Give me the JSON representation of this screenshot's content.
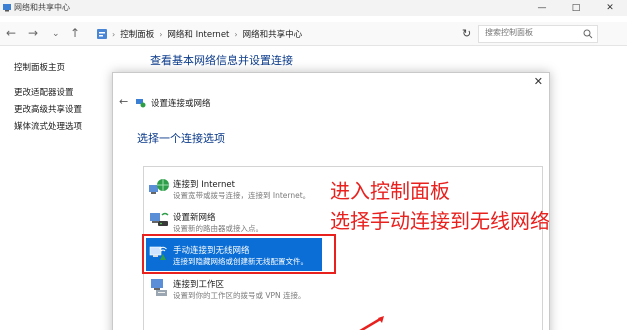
{
  "window": {
    "title": "网络和共享中心",
    "controls": {
      "minimize": "—",
      "maximize": "□",
      "close": "✕"
    }
  },
  "addressbar": {
    "breadcrumbs": [
      "控制面板",
      "网络和 Internet",
      "网络和共享中心"
    ],
    "search_placeholder": "搜索控制面板"
  },
  "left_nav": {
    "home": "控制面板主页",
    "items": [
      "更改适配器设置",
      "更改高级共享设置",
      "媒体流式处理选项"
    ]
  },
  "main": {
    "heading": "查看基本网络信息并设置连接"
  },
  "dialog": {
    "title": "设置连接或网络",
    "prompt": "选择一个连接选项",
    "close": "✕",
    "options": [
      {
        "title": "连接到 Internet",
        "desc": "设置宽带或拨号连接，连接到 Internet。",
        "icon": "globe-network-icon",
        "selected": false
      },
      {
        "title": "设置新网络",
        "desc": "设置新的路由器或接入点。",
        "icon": "router-icon",
        "selected": false
      },
      {
        "title": "手动连接到无线网络",
        "desc": "连接到隐藏网络或创建新无线配置文件。",
        "icon": "wireless-network-icon",
        "selected": true
      },
      {
        "title": "连接到工作区",
        "desc": "设置到你的工作区的拨号或 VPN 连接。",
        "icon": "workplace-icon",
        "selected": false
      }
    ]
  },
  "annotation": {
    "line1": "进入控制面板",
    "line2": "选择手动连接到无线网络",
    "color": "#e8201e"
  },
  "colors": {
    "accent": "#0a6ed6",
    "heading": "#0a3a8a",
    "annotation": "#e8201e"
  }
}
